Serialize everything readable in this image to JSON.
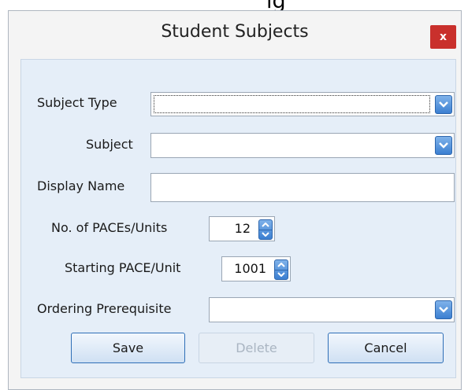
{
  "cutoff_text": "ig",
  "dialog": {
    "title": "Student Subjects",
    "close_label": "x"
  },
  "form": {
    "subject_type": {
      "label": "Subject Type",
      "value": ""
    },
    "subject": {
      "label": "Subject",
      "value": ""
    },
    "display_name": {
      "label": "Display Name",
      "value": ""
    },
    "paces": {
      "label": "No. of PACEs/Units",
      "value": "12"
    },
    "starting": {
      "label": "Starting PACE/Unit",
      "value": "1001"
    },
    "prereq": {
      "label": "Ordering Prerequisite",
      "value": ""
    }
  },
  "buttons": {
    "save": "Save",
    "delete": "Delete",
    "cancel": "Cancel"
  },
  "icons": {
    "dropdown": "chevron-down-icon",
    "spin_up": "arrow-up-icon",
    "spin_down": "arrow-down-icon"
  },
  "colors": {
    "close": "#c9302c",
    "accent": "#3b7fd1",
    "panel": "#e5eef8"
  }
}
